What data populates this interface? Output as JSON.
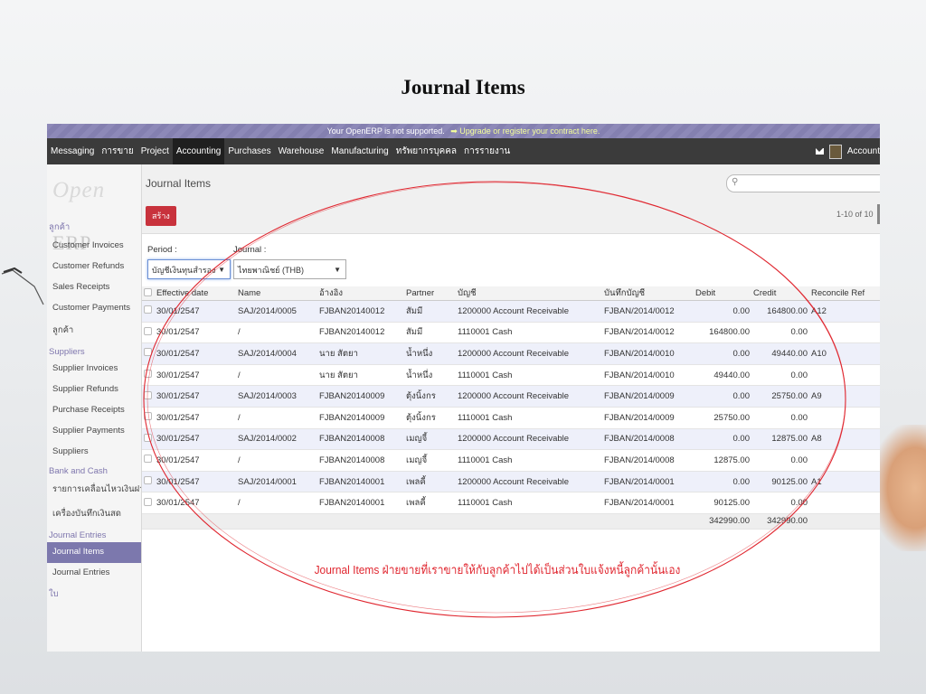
{
  "slide": {
    "title": "Journal Items",
    "annotation": "Journal Items ฝ่ายขายที่เราขายให้กับลูกค้าไปได้เป็นส่วนใบแจ้งหนี้ลูกค้านั้นเอง"
  },
  "banner": {
    "text": "Your OpenERP is not supported.",
    "link": "➡ Upgrade or register your contract here."
  },
  "menu": {
    "items": [
      "Messaging",
      "การขาย",
      "Project",
      "Accounting",
      "Purchases",
      "Warehouse",
      "Manufacturing",
      "ทรัพยากรบุคคล",
      "การรายงาน"
    ],
    "active": "Accounting",
    "account": "Account"
  },
  "logo": {
    "open": "Open",
    "erp": "ERP"
  },
  "sidebar": {
    "sections": [
      {
        "title": "ลูกค้า",
        "items": [
          "Customer Invoices",
          "Customer Refunds",
          "Sales Receipts",
          "Customer Payments",
          "ลูกค้า"
        ]
      },
      {
        "title": "Suppliers",
        "items": [
          "Supplier Invoices",
          "Supplier Refunds",
          "Purchase Receipts",
          "Supplier Payments",
          "Suppliers"
        ]
      },
      {
        "title": "Bank and Cash",
        "items": [
          "รายการเคลื่อนไหวเงินฝาก...",
          "เครื่องบันทึกเงินสด"
        ]
      },
      {
        "title": "Journal Entries",
        "items": [
          "Journal Items",
          "Journal Entries"
        ]
      }
    ],
    "active_item": "Journal Items",
    "extra_section": "ใบ"
  },
  "view": {
    "title": "Journal Items",
    "create_label": "สร้าง",
    "search_icon": "search-icon",
    "search_placeholder": "",
    "pager": "1-10 of 10"
  },
  "filters": {
    "period_label": "Period :",
    "period_value": "บัญชีเงินทุนสำรอง",
    "journal_label": "Journal :",
    "journal_value": "ไทยพาณิชย์ (THB)"
  },
  "table": {
    "columns": [
      "Effective date",
      "Name",
      "อ้างอิง",
      "Partner",
      "บัญชี",
      "บันทึกบัญชี",
      "Debit",
      "Credit",
      "Reconcile Ref"
    ],
    "rows": [
      [
        "30/01/2547",
        "SAJ/2014/0005",
        "FJBAN20140012",
        "สัมมี",
        "1200000 Account Receivable",
        "FJBAN/2014/0012",
        "0.00",
        "164800.00",
        "A12"
      ],
      [
        "30/01/2547",
        "/",
        "FJBAN20140012",
        "สัมมี",
        "1110001 Cash",
        "FJBAN/2014/0012",
        "164800.00",
        "0.00",
        ""
      ],
      [
        "30/01/2547",
        "SAJ/2014/0004",
        "นาย สัตยา",
        "น้ำหนึ่ง",
        "1200000 Account Receivable",
        "FJBAN/2014/0010",
        "0.00",
        "49440.00",
        "A10"
      ],
      [
        "30/01/2547",
        "/",
        "นาย สัตยา",
        "น้ำหนึ่ง",
        "1110001 Cash",
        "FJBAN/2014/0010",
        "49440.00",
        "0.00",
        ""
      ],
      [
        "30/01/2547",
        "SAJ/2014/0003",
        "FJBAN20140009",
        "ตุ้งนิ้งกร",
        "1200000 Account Receivable",
        "FJBAN/2014/0009",
        "0.00",
        "25750.00",
        "A9"
      ],
      [
        "30/01/2547",
        "/",
        "FJBAN20140009",
        "ตุ้งนิ้งกร",
        "1110001 Cash",
        "FJBAN/2014/0009",
        "25750.00",
        "0.00",
        ""
      ],
      [
        "30/01/2547",
        "SAJ/2014/0002",
        "FJBAN20140008",
        "เมญจี้",
        "1200000 Account Receivable",
        "FJBAN/2014/0008",
        "0.00",
        "12875.00",
        "A8"
      ],
      [
        "30/01/2547",
        "/",
        "FJBAN20140008",
        "เมญจี้",
        "1110001 Cash",
        "FJBAN/2014/0008",
        "12875.00",
        "0.00",
        ""
      ],
      [
        "30/01/2547",
        "SAJ/2014/0001",
        "FJBAN20140001",
        "เพลคี้",
        "1200000 Account Receivable",
        "FJBAN/2014/0001",
        "0.00",
        "90125.00",
        "A1"
      ],
      [
        "30/01/2547",
        "/",
        "FJBAN20140001",
        "เพลคี้",
        "1110001 Cash",
        "FJBAN/2014/0001",
        "90125.00",
        "0.00",
        ""
      ]
    ],
    "totals": {
      "debit": "342990.00",
      "credit": "342990.00"
    }
  },
  "colors": {
    "accent": "#7c78ad",
    "create": "#c8323c",
    "annotation": "#e0262f"
  }
}
